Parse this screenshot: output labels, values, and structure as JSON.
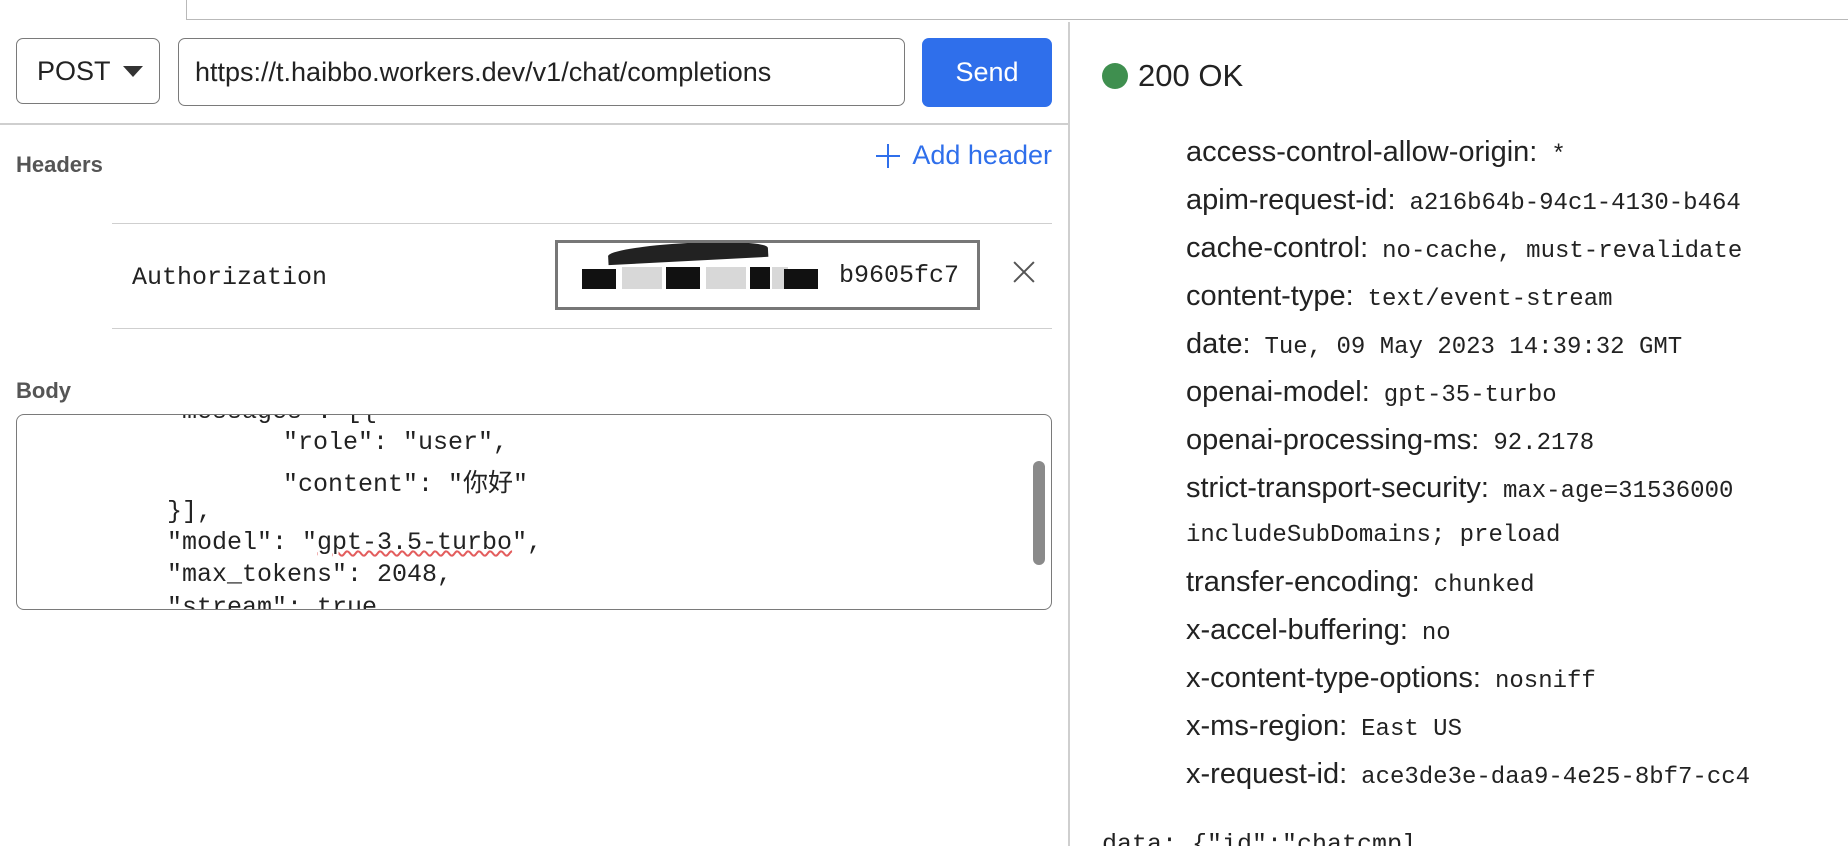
{
  "request": {
    "method": "POST",
    "url": "https://t.haibbo.workers.dev/v1/chat/completions",
    "send_label": "Send",
    "headers_label": "Headers",
    "add_header_label": "Add header",
    "header_rows": [
      {
        "key": "Authorization",
        "value_visible": "b9605fc7"
      }
    ],
    "body_label": "Body",
    "body_lines": [
      "\"messages\": [{",
      "        \"role\": \"user\",",
      "        \"content\": \"你好\"",
      "}],",
      "\"model\": \"gpt-3.5-turbo\",",
      "\"max_tokens\": 2048,",
      "\"stream\": true"
    ]
  },
  "response": {
    "status": "200 OK",
    "status_color": "#3f8f4f",
    "headers": [
      {
        "key": "access-control-allow-origin:",
        "value": "*"
      },
      {
        "key": "apim-request-id:",
        "value": "a216b64b-94c1-4130-b464"
      },
      {
        "key": "cache-control:",
        "value": "no-cache, must-revalidate"
      },
      {
        "key": "content-type:",
        "value": "text/event-stream"
      },
      {
        "key": "date:",
        "value": "Tue, 09 May 2023 14:39:32 GMT"
      },
      {
        "key": "openai-model:",
        "value": "gpt-35-turbo"
      },
      {
        "key": "openai-processing-ms:",
        "value": "92.2178"
      },
      {
        "key": "strict-transport-security:",
        "value": "max-age=31536000"
      },
      {
        "key": "transfer-encoding:",
        "value": "chunked"
      },
      {
        "key": "x-accel-buffering:",
        "value": "no"
      },
      {
        "key": "x-content-type-options:",
        "value": "nosniff"
      },
      {
        "key": "x-ms-region:",
        "value": "East US"
      },
      {
        "key": "x-request-id:",
        "value": "ace3de3e-daa9-4e25-8bf7-cc4"
      }
    ],
    "hsts_continuation": "includeSubDomains; preload",
    "data_preview": "data: {\"id\":\"chatcmpl"
  },
  "colors": {
    "accent": "#2f6feb"
  }
}
